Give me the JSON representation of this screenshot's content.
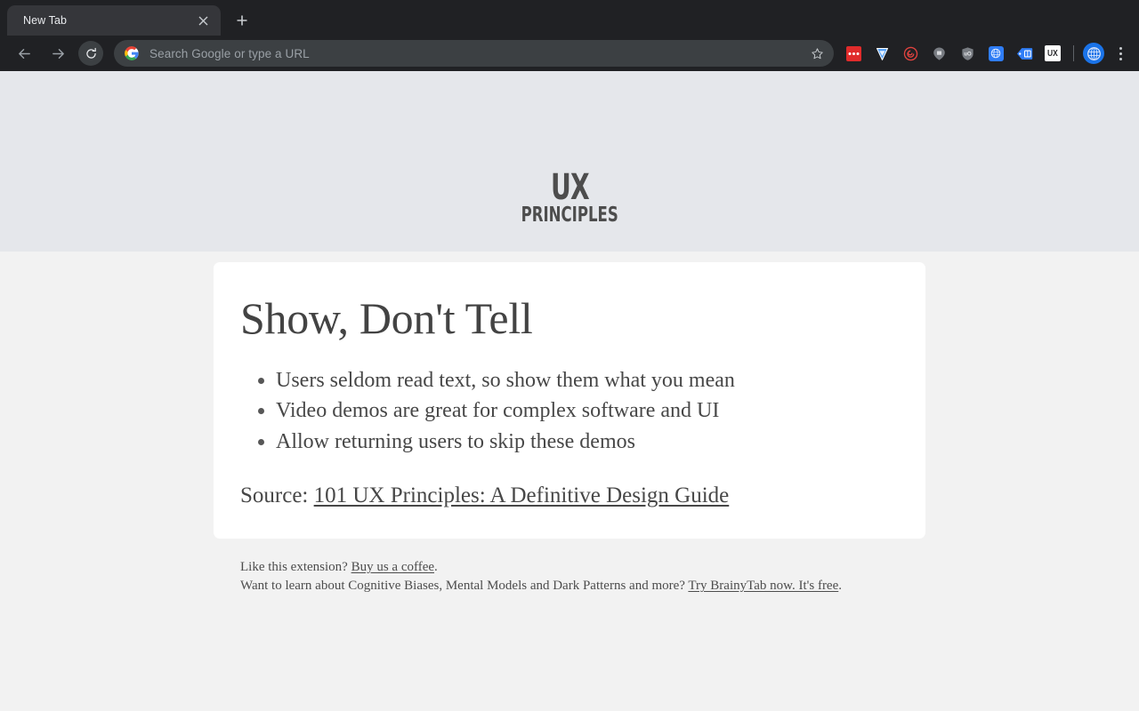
{
  "browser": {
    "tab": {
      "title": "New Tab",
      "close_icon": "close-icon"
    },
    "new_tab_button": "plus-icon",
    "nav": {
      "back": "back-arrow-icon",
      "forward": "forward-arrow-icon",
      "reload": "reload-icon"
    },
    "omnibox": {
      "placeholder": "Search Google or type a URL",
      "value": "",
      "search_engine_icon": "google-g-icon",
      "bookmark_icon": "star-outline-icon"
    },
    "extensions": [
      {
        "name": "extension-red-dots",
        "icon": "red-dots-icon",
        "color": "#e53935",
        "glyph": "•••"
      },
      {
        "name": "extension-diamond",
        "icon": "diamond-icon",
        "color": "#3b7de0",
        "glyph": "◆"
      },
      {
        "name": "extension-spiral",
        "icon": "spiral-icon",
        "color": "#e53935",
        "glyph": "◎"
      },
      {
        "name": "extension-chat-pin",
        "icon": "chat-pin-icon",
        "color": "#7a7d82",
        "glyph": "⬤"
      },
      {
        "name": "extension-ublock-origin",
        "icon": "shield-ub-icon",
        "color": "#7a7d82",
        "glyph": "uO"
      },
      {
        "name": "extension-globe-blue",
        "icon": "globe-blue-icon",
        "color": "#2f7df6",
        "glyph": "●"
      },
      {
        "name": "extension-bookmark-tag",
        "icon": "bookmark-tag-icon",
        "color": "#2f7df6",
        "glyph": "B"
      },
      {
        "name": "extension-ux-principles",
        "icon": "ux-icon",
        "color": "#ffffff",
        "glyph": "UX"
      }
    ],
    "profile_avatar": "globe-avatar-icon",
    "menu_button": "three-dot-menu-icon"
  },
  "page": {
    "logo": {
      "line1": "UX",
      "line2": "PRINCIPLES"
    },
    "card": {
      "title": "Show, Don't Tell",
      "bullets": [
        "Users seldom read text, so show them what you mean",
        "Video demos are great for complex software and UI",
        "Allow returning users to skip these demos"
      ],
      "source_label": "Source: ",
      "source_link": "101 UX Principles: A Definitive Design Guide"
    },
    "footer": {
      "line1_prefix": "Like this extension? ",
      "line1_link": "Buy us a coffee",
      "line1_suffix": ".",
      "line2_prefix": "Want to learn about Cognitive Biases, Mental Models and Dark Patterns and more? ",
      "line2_link": "Try BrainyTab now. It's free",
      "line2_suffix": "."
    }
  },
  "colors": {
    "chrome_bg": "#202124",
    "tab_active": "#35363a",
    "omnibox_bg": "#3c4043",
    "hero_band": "#e5e7eb",
    "page_bg": "#f2f2f2",
    "card_bg": "#ffffff",
    "text": "#474747",
    "accent_blue": "#1a73e8"
  }
}
